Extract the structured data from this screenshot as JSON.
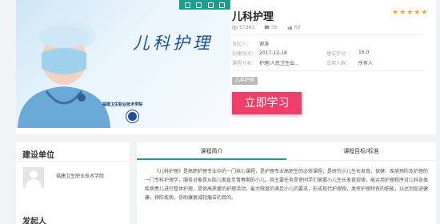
{
  "course": {
    "title": "儿科护理",
    "cover_title": "儿科护理",
    "cover_school": "福建卫生职业技术学院",
    "rating_stars": 5,
    "views": "57381",
    "comments": "36",
    "likes": "60",
    "tag": "儿科护理",
    "study_button": "立即学习"
  },
  "meta": {
    "publisher_label": "发起人：",
    "publisher_value": "谢涛",
    "created_label": "创建时间：",
    "created_value": "2017-12-18",
    "credits_label": "建议学分：",
    "credits_value": "16.0",
    "category_label": "课程分类：",
    "category_value": "护理/人民卫生出...",
    "audience_label": "适用人群：",
    "audience_value": "所有人"
  },
  "unit_panel": {
    "title": "建设单位",
    "unit_name": "福建卫生职业技术学院",
    "publisher_title": "发起人"
  },
  "tabs": [
    {
      "label": "课程简介",
      "active": true
    },
    {
      "label": "课程目标/标准",
      "active": false
    }
  ],
  "intro": "《儿科护理》是高职护理专业中的一门核心课程，是护理专业高职生的必修课程，是研究小儿生长发育、保健、疾病预防及护理的一门专科护理学，服务对象是从胎儿期直至青春期的小儿。其主要任务是使同学们掌握小儿生长发育规律，能运用护理程序对儿科各类疾病患儿进行整体护理，提供高质量的护理活动，最大限度的满足小儿的要求，形成现代护理观，发挥护理特有的职能，以达到促进健康，预防疾病，协助康复减轻痛苦的目的。",
  "colors": {
    "accent": "#1f9c8e",
    "button": "#ee3e6a",
    "star": "#f2a830"
  }
}
